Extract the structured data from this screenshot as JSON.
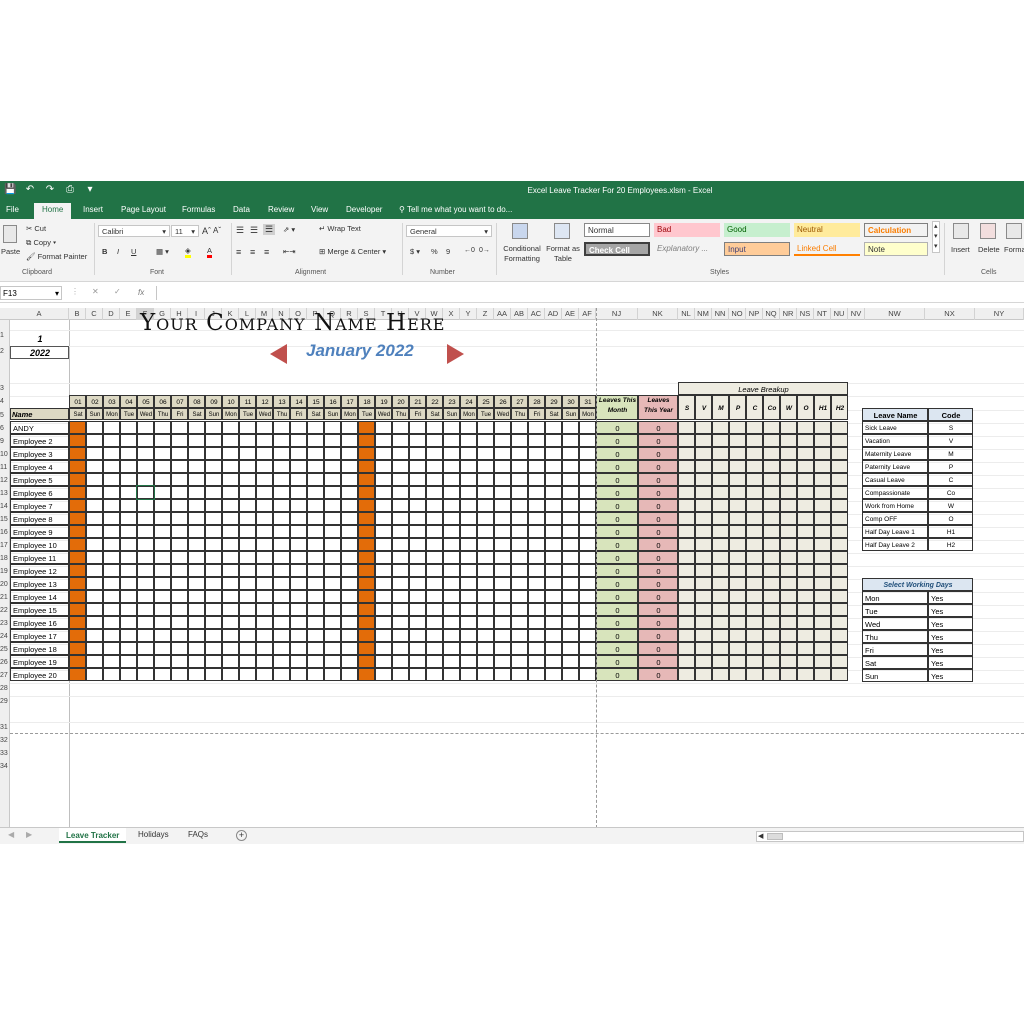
{
  "window": {
    "title": "Excel Leave Tracker For 20 Employees.xlsm - Excel"
  },
  "tabs": [
    "File",
    "Home",
    "Insert",
    "Page Layout",
    "Formulas",
    "Data",
    "Review",
    "View",
    "Developer",
    "Tell me what you want to do..."
  ],
  "ribbon": {
    "clipboard": {
      "paste": "Paste",
      "cut": "Cut",
      "copy": "Copy",
      "format_painter": "Format Painter",
      "label": "Clipboard"
    },
    "font": {
      "name": "Calibri",
      "size": "11",
      "bold": "B",
      "italic": "I",
      "underline": "U",
      "label": "Font"
    },
    "alignment": {
      "wrap": "Wrap Text",
      "merge": "Merge & Center",
      "label": "Alignment"
    },
    "number": {
      "format": "General",
      "currency": "$",
      "percent": "%",
      "comma": "9",
      "label": "Number"
    },
    "styles": {
      "conditional": "Conditional Formatting",
      "format_table": "Format as Table",
      "cells": [
        "Normal",
        "Bad",
        "Good",
        "Neutral",
        "Calculation",
        "Check Cell",
        "Explanatory ...",
        "Input",
        "Linked Cell",
        "Note"
      ],
      "label": "Styles"
    },
    "cells": {
      "insert": "Insert",
      "delete": "Delete",
      "format": "Forma",
      "label": "Cells"
    }
  },
  "formula_bar": {
    "name_box": "F13",
    "fx": "fx",
    "value": ""
  },
  "columns": [
    "A",
    "B",
    "C",
    "D",
    "E",
    "F",
    "G",
    "H",
    "I",
    "J",
    "K",
    "L",
    "M",
    "N",
    "O",
    "P",
    "Q",
    "R",
    "S",
    "T",
    "U",
    "V",
    "W",
    "X",
    "Y",
    "Z",
    "AA",
    "AB",
    "AC",
    "AD",
    "AE",
    "AF",
    "NJ",
    "NK",
    "NL",
    "NM",
    "NN",
    "NO",
    "NP",
    "NQ",
    "NR",
    "NS",
    "NT",
    "NU",
    "NV",
    "NW",
    "NX",
    "NY"
  ],
  "rows": [
    "1",
    "2",
    "3",
    "4",
    "5",
    "6",
    "9",
    "10",
    "11",
    "12",
    "13",
    "14",
    "15",
    "16",
    "17",
    "18",
    "19",
    "20",
    "21",
    "22",
    "23",
    "24",
    "25",
    "26",
    "27",
    "28",
    "29",
    "31",
    "32",
    "33",
    "34"
  ],
  "sheet": {
    "company_title": "Your Company Name Here",
    "month_label": "January 2022",
    "month_num": "1",
    "year": "2022",
    "name_header": "Name",
    "days": [
      "01",
      "02",
      "03",
      "04",
      "05",
      "06",
      "07",
      "08",
      "09",
      "10",
      "11",
      "12",
      "13",
      "14",
      "15",
      "16",
      "17",
      "18",
      "19",
      "20",
      "21",
      "22",
      "23",
      "24",
      "25",
      "26",
      "27",
      "28",
      "29",
      "30",
      "31"
    ],
    "weekdays": [
      "Sat",
      "Sun",
      "Mon",
      "Tue",
      "Wed",
      "Thu",
      "Fri",
      "Sat",
      "Sun",
      "Mon",
      "Tue",
      "Wed",
      "Thu",
      "Fri",
      "Sat",
      "Sun",
      "Mon",
      "Tue",
      "Wed",
      "Thu",
      "Fri",
      "Sat",
      "Sun",
      "Mon",
      "Tue",
      "Wed",
      "Thu",
      "Fri",
      "Sat",
      "Sun",
      "Mon"
    ],
    "employees": [
      "ANDY",
      "Employee 2",
      "Employee 3",
      "Employee 4",
      "Employee 5",
      "Employee 6",
      "Employee 7",
      "Employee 8",
      "Employee 9",
      "Employee 10",
      "Employee 11",
      "Employee 12",
      "Employee 13",
      "Employee 14",
      "Employee 15",
      "Employee 16",
      "Employee 17",
      "Employee 18",
      "Employee 19",
      "Employee 20"
    ],
    "leaves_month_header": "Leaves This Month",
    "leaves_year_header": "Leaves This Year",
    "zero": "0",
    "breakup_header": "Leave Breakup",
    "breakup_codes": [
      "S",
      "V",
      "M",
      "P",
      "C",
      "Co",
      "W",
      "O",
      "H1",
      "H2"
    ]
  },
  "leave_table": {
    "header_name": "Leave Name",
    "header_code": "Code",
    "rows": [
      [
        "Sick Leave",
        "S"
      ],
      [
        "Vacation",
        "V"
      ],
      [
        "Maternity Leave",
        "M"
      ],
      [
        "Paternity Leave",
        "P"
      ],
      [
        "Casual Leave",
        "C"
      ],
      [
        "Compassionate",
        "Co"
      ],
      [
        "Work from Home",
        "W"
      ],
      [
        "Comp OFF",
        "O"
      ],
      [
        "Half Day Leave 1",
        "H1"
      ],
      [
        "Half Day Leave 2",
        "H2"
      ]
    ]
  },
  "working_days": {
    "header": "Select Working Days",
    "rows": [
      [
        "Mon",
        "Yes"
      ],
      [
        "Tue",
        "Yes"
      ],
      [
        "Wed",
        "Yes"
      ],
      [
        "Thu",
        "Yes"
      ],
      [
        "Fri",
        "Yes"
      ],
      [
        "Sat",
        "Yes"
      ],
      [
        "Sun",
        "Yes"
      ]
    ]
  },
  "sheet_tabs": [
    "Leave Tracker",
    "Holidays",
    "FAQs"
  ],
  "colors": {
    "excel_green": "#217346",
    "weekend": "#e36c09",
    "month_blue": "#4f81bd",
    "arrow_red": "#c0504d",
    "month_col": "#d8e4bc",
    "year_col": "#e6b8b7",
    "breakup": "#eeece1"
  }
}
